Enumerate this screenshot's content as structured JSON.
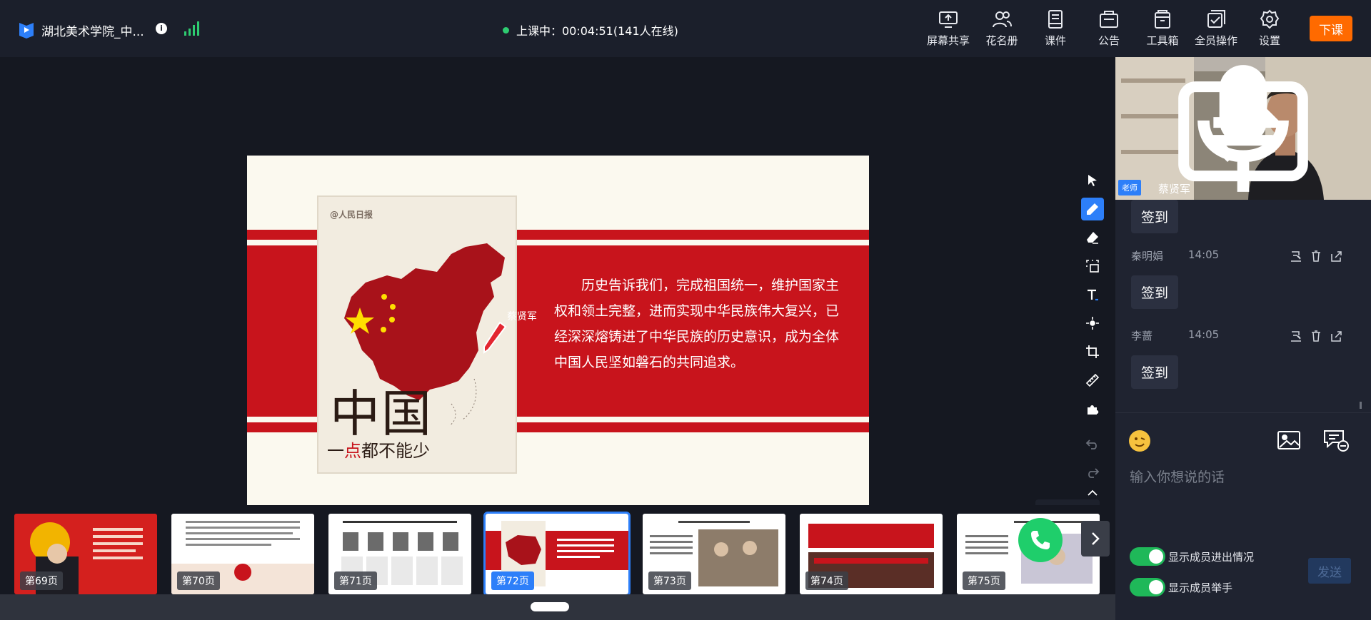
{
  "header": {
    "title": "湖北美术学院_中...",
    "status": "上课中：00:04:51(141人在线)",
    "end_class": "下课",
    "tools": [
      {
        "label": "屏幕共享",
        "icon": "screen-share-icon"
      },
      {
        "label": "花名册",
        "icon": "roster-icon"
      },
      {
        "label": "课件",
        "icon": "courseware-icon"
      },
      {
        "label": "公告",
        "icon": "announcement-icon"
      },
      {
        "label": "工具箱",
        "icon": "toolbox-icon"
      },
      {
        "label": "全员操作",
        "icon": "all-members-icon"
      },
      {
        "label": "设置",
        "icon": "gear-icon"
      }
    ],
    "accent": "#ff6a00"
  },
  "slide": {
    "poster_logo": "@人民日报",
    "poster_title": "中国",
    "poster_sub_a": "一",
    "poster_sub_b": "点",
    "poster_sub_c": "都不能少",
    "text": "历史告诉我们，完成祖国统一，维护国家主权和领土完整，进而实现中华民族伟大复兴，已经深深熔铸进了中华民族的历史意识，成为全体中国人民坚如磐石的共同追求。",
    "cursor_name": "蔡贤军",
    "theme_red": "#c8141c"
  },
  "annotation_tools": [
    "select-icon",
    "pen-icon",
    "eraser-icon",
    "selection-crop-icon",
    "text-icon",
    "laser-pointer-icon",
    "crop-icon",
    "ruler-icon",
    "puzzle-icon",
    "undo-icon",
    "redo-icon",
    "collapse-icon"
  ],
  "thumbnails": [
    {
      "label": "第69页"
    },
    {
      "label": "第70页"
    },
    {
      "label": "第71页"
    },
    {
      "label": "第72页",
      "active": true
    },
    {
      "label": "第73页"
    },
    {
      "label": "第74页"
    },
    {
      "label": "第75页"
    }
  ],
  "side": {
    "role": "老师",
    "speaker": "蔡贤军",
    "messages": [
      {
        "name": "",
        "time": "",
        "text": "签到"
      },
      {
        "name": "秦明娟",
        "time": "14:05",
        "text": "签到"
      },
      {
        "name": "李蔷",
        "time": "14:05",
        "text": "签到"
      }
    ],
    "input_placeholder": "输入你想说的话",
    "toggle_1": "显示成员进出情况",
    "toggle_2": "显示成员举手",
    "send": "发送"
  }
}
